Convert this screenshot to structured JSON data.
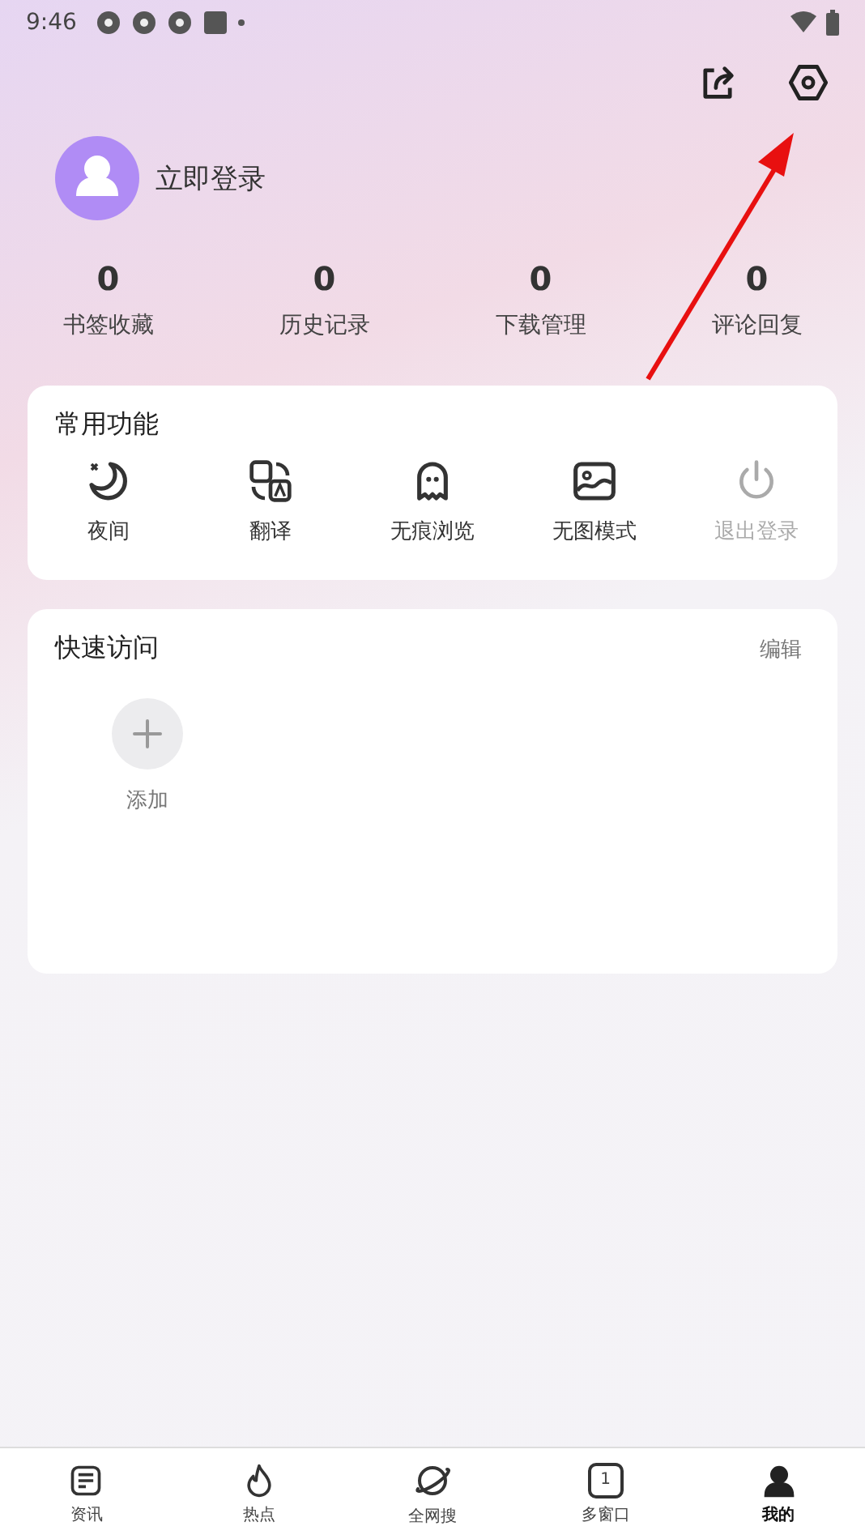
{
  "status_bar": {
    "time": "9:46"
  },
  "profile": {
    "login_label": "立即登录"
  },
  "stats": [
    {
      "value": "0",
      "label": "书签收藏"
    },
    {
      "value": "0",
      "label": "历史记录"
    },
    {
      "value": "0",
      "label": "下载管理"
    },
    {
      "value": "0",
      "label": "评论回复"
    }
  ],
  "common_functions": {
    "title": "常用功能",
    "items": [
      {
        "kind": "moon",
        "label": "夜间",
        "disabled": false
      },
      {
        "kind": "translate",
        "label": "翻译",
        "disabled": false
      },
      {
        "kind": "ghost",
        "label": "无痕浏览",
        "disabled": false
      },
      {
        "kind": "image",
        "label": "无图模式",
        "disabled": false
      },
      {
        "kind": "power",
        "label": "退出登录",
        "disabled": true
      }
    ]
  },
  "quick_access": {
    "title": "快速访问",
    "edit": "编辑",
    "add_label": "添加"
  },
  "bottom_nav": [
    {
      "kind": "news",
      "label": "资讯",
      "selected": false
    },
    {
      "kind": "fire",
      "label": "热点",
      "selected": false
    },
    {
      "kind": "planet",
      "label": "全网搜",
      "selected": false
    },
    {
      "kind": "windows",
      "label": "多窗口",
      "selected": false,
      "count": "1"
    },
    {
      "kind": "me",
      "label": "我的",
      "selected": true
    }
  ]
}
